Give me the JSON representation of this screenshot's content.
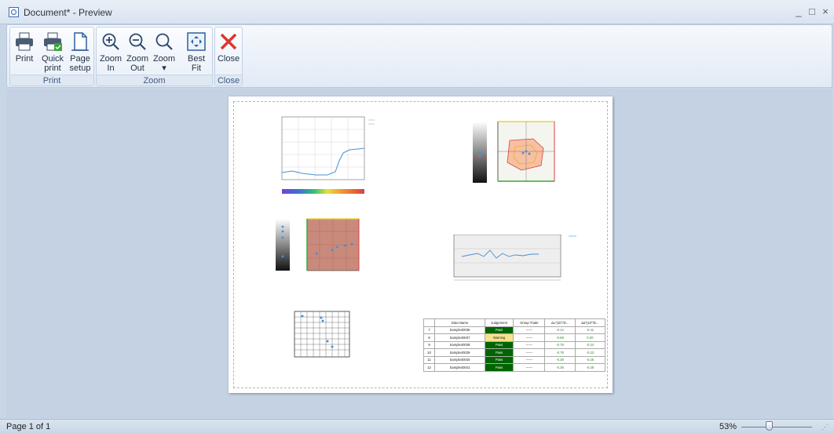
{
  "window": {
    "title": "Document* - Preview",
    "minimize": "_",
    "maximize": "□",
    "close": "×"
  },
  "ribbon": {
    "print_group": {
      "label": "Print",
      "print": "Print",
      "quick_print_1": "Quick",
      "quick_print_2": "print",
      "page_setup_1": "Page",
      "page_setup_2": "setup"
    },
    "zoom_group": {
      "label": "Zoom",
      "zoom_in_1": "Zoom",
      "zoom_in_2": "In",
      "zoom_out_1": "Zoom",
      "zoom_out_2": "Out",
      "zoom_1": "Zoom",
      "zoom_2": "▾",
      "best_fit_1": "Best",
      "best_fit_2": "Fit"
    },
    "close_group": {
      "label": "Close",
      "close": "Close"
    }
  },
  "page": {
    "table": {
      "headers": [
        "",
        "Data Name",
        "Judgement",
        "Group Trade",
        "ΔL*(10°/D...",
        "Δa*(10°/D..."
      ],
      "rows": [
        {
          "id": "7",
          "name": "Sample40036",
          "judgement": "Pass",
          "group": "------",
          "dl": "-0.14",
          "da": "-0.41"
        },
        {
          "id": "8",
          "name": "Sample40037",
          "judgement": "Warning",
          "group": "------",
          "dl": "-0.68",
          "da": "0.00"
        },
        {
          "id": "9",
          "name": "Sample40038",
          "judgement": "Pass",
          "group": "------",
          "dl": "-0.78",
          "da": "-0.24"
        },
        {
          "id": "10",
          "name": "Sample40039",
          "judgement": "Pass",
          "group": "------",
          "dl": "-0.78",
          "da": "-0.23"
        },
        {
          "id": "11",
          "name": "Sample40040",
          "judgement": "Pass",
          "group": "------",
          "dl": "-0.38",
          "da": "-0.26"
        },
        {
          "id": "12",
          "name": "Sample40041",
          "judgement": "Pass",
          "group": "------",
          "dl": "-0.39",
          "da": "-0.29"
        }
      ]
    }
  },
  "status": {
    "page": "Page 1 of 1",
    "zoom": "53%"
  },
  "colors": {
    "pass": "#006400",
    "warning": "#f5e38c",
    "close_icon": "#d9382c",
    "icon_blue": "#2f5f9e"
  }
}
